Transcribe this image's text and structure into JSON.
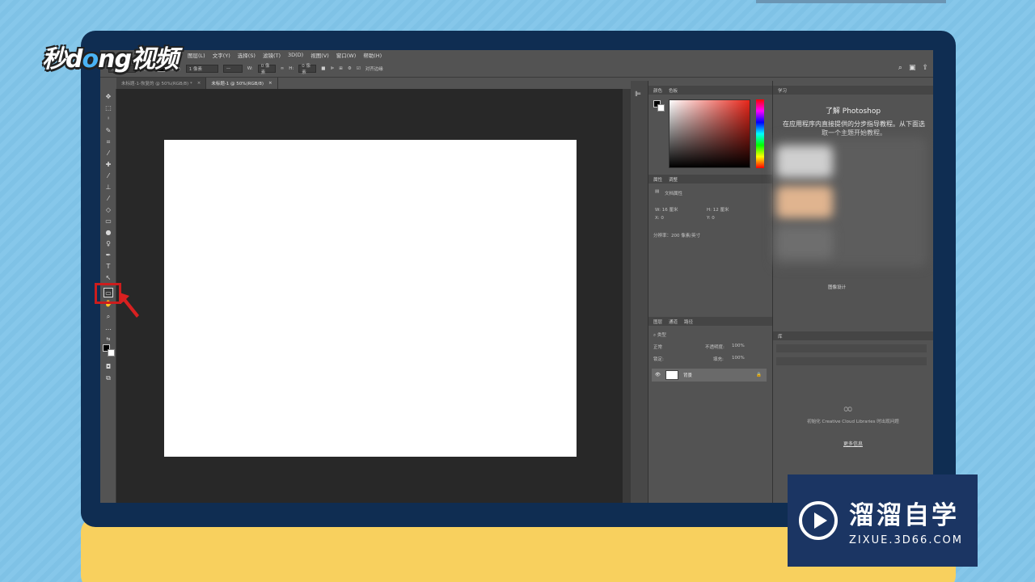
{
  "branding": {
    "logo_pre": "秒d",
    "logo_o": "o",
    "logo_post": "ng视频",
    "watermark_title": "溜溜自学",
    "watermark_url": "ZIXUE.3D66.COM"
  },
  "menu": [
    "图层(L)",
    "文字(Y)",
    "选择(S)",
    "滤镜(T)",
    "3D(D)",
    "视图(V)",
    "窗口(W)",
    "帮助(H)"
  ],
  "options": {
    "shape_mode": "形状",
    "fill_label": "填充:",
    "stroke_label": "描边:",
    "stroke_width": "1 像素",
    "w_label": "W:",
    "w_value": "0 像素",
    "h_label": "H:",
    "h_value": "0 像素",
    "align_edges": "对齐边缘"
  },
  "tabs": [
    {
      "label": "未标题-1-恢复的 @ 50%(RGB/8) *",
      "active": false
    },
    {
      "label": "未标题-1 @ 50%(RGB/8)",
      "active": true
    }
  ],
  "color_panel": {
    "tab1": "颜色",
    "tab2": "色板"
  },
  "properties_panel": {
    "tab1": "属性",
    "tab2": "调整",
    "section": "文档属性",
    "w": "W:  16 厘米",
    "h": "H:  12 厘米",
    "x": "X:  0",
    "y": "Y:  0",
    "resolution": "分辨率：200 像素/英寸"
  },
  "layers_panel": {
    "tab1": "图层",
    "tab2": "通道",
    "tab3": "路径",
    "filter": "类型",
    "blend": "正常",
    "opacity_label": "不透明度:",
    "opacity": "100%",
    "lock_label": "锁定:",
    "fill_label": "填充:",
    "fill": "100%",
    "layer_name": "背景"
  },
  "learn_panel": {
    "tab": "学习",
    "title": "了解 Photoshop",
    "subtitle": "在应用程序内直接提供的分步指导教程。从下面选取一个主题开始教程。",
    "item": "图像设计"
  },
  "libraries_panel": {
    "tab": "库",
    "message": "初始化 Creative Cloud Libraries 时出现问题",
    "link": "更多信息"
  }
}
